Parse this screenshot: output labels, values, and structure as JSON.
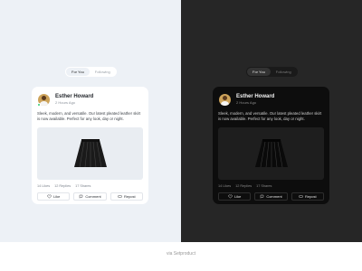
{
  "tabs": [
    {
      "label": "For You"
    },
    {
      "label": "Following"
    }
  ],
  "post": {
    "author_name": "Esther Howard",
    "timestamp": "2 Hours Ago",
    "text": "Sleek, modern, and versatile. Our latest pleated leather skirt is now available. Perfect for any look, day or night.",
    "stats": {
      "likes": "14 Likes",
      "replies": "12 Replies",
      "shares": "17 Shares"
    },
    "actions": {
      "like": "Like",
      "comment": "Comment",
      "repost": "Repost"
    }
  },
  "footer": {
    "credit": "via Setproduct"
  },
  "colors": {
    "light_bg": "#edf1f6",
    "dark_bg": "#262626",
    "online_dot": "#2ecc71"
  },
  "icons": [
    "avatar",
    "leather-skirt-image",
    "heart-icon",
    "comment-icon",
    "repost-icon"
  ]
}
